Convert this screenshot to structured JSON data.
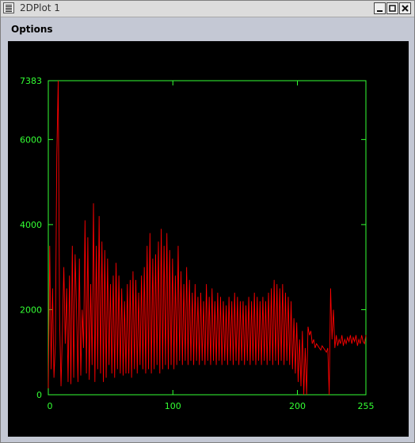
{
  "window": {
    "title": "2DPlot 1",
    "buttons": [
      "minimize",
      "maximize",
      "close"
    ]
  },
  "menubar": {
    "options_label": "Options"
  },
  "colors": {
    "plot_background": "#000000",
    "axis": "#33ff33",
    "series": "#ff0000",
    "chrome": "#c4c8d4"
  },
  "chart_data": {
    "type": "line",
    "title": "",
    "xlabel": "",
    "ylabel": "",
    "xlim": [
      0,
      255
    ],
    "ylim": [
      0,
      7383
    ],
    "x_ticks": [
      0,
      100,
      200,
      255
    ],
    "y_ticks": [
      0,
      2000,
      4000,
      6000,
      7383
    ],
    "grid": false,
    "series": [
      {
        "color": "#ff0000",
        "values": [
          150,
          3500,
          600,
          2500,
          400,
          1200,
          5600,
          7383,
          1800,
          200,
          1500,
          3000,
          1200,
          2500,
          300,
          2800,
          250,
          3500,
          400,
          3300,
          2000,
          300,
          3200,
          450,
          2000,
          1100,
          4100,
          500,
          3700,
          350,
          2600,
          700,
          4500,
          300,
          3500,
          600,
          4200,
          500,
          3600,
          300,
          3400,
          400,
          3200,
          700,
          2600,
          500,
          2800,
          400,
          3100,
          600,
          2800,
          500,
          2500,
          450,
          2200,
          500,
          2600,
          500,
          2700,
          400,
          2900,
          600,
          2700,
          500,
          2400,
          700,
          2800,
          600,
          3000,
          500,
          3500,
          600,
          3800,
          500,
          3200,
          600,
          3300,
          700,
          3600,
          500,
          3900,
          600,
          3500,
          700,
          3800,
          600,
          3400,
          700,
          3200,
          600,
          2800,
          700,
          3500,
          800,
          2900,
          700,
          2600,
          800,
          3000,
          700,
          2700,
          800,
          2400,
          700,
          2600,
          800,
          2300,
          700,
          2400,
          800,
          2200,
          700,
          2600,
          800,
          2300,
          700,
          2500,
          800,
          2200,
          700,
          2400,
          800,
          2300,
          700,
          2200,
          800,
          2100,
          700,
          2300,
          800,
          2200,
          700,
          2400,
          800,
          2300,
          700,
          2200,
          800,
          2200,
          700,
          2100,
          800,
          2300,
          700,
          2200,
          800,
          2400,
          700,
          2300,
          800,
          2200,
          700,
          2300,
          800,
          2200,
          700,
          2400,
          800,
          2500,
          700,
          2700,
          800,
          2600,
          700,
          2500,
          800,
          2600,
          700,
          2400,
          800,
          2300,
          700,
          2200,
          600,
          1800,
          500,
          1700,
          300,
          1300,
          200,
          1500,
          0,
          1100,
          0,
          1600,
          1400,
          1500,
          1200,
          1300,
          1100,
          1200,
          1150,
          1100,
          1050,
          1150,
          1100,
          1050,
          1000,
          1100,
          0,
          2500,
          1300,
          2000,
          1100,
          1400,
          1150,
          1300,
          1200,
          1400,
          1150,
          1300,
          1200,
          1350,
          1250,
          1400,
          1200,
          1350,
          1250,
          1400,
          1150,
          1300,
          1200,
          1400,
          1250,
          1200,
          1400
        ]
      }
    ]
  }
}
